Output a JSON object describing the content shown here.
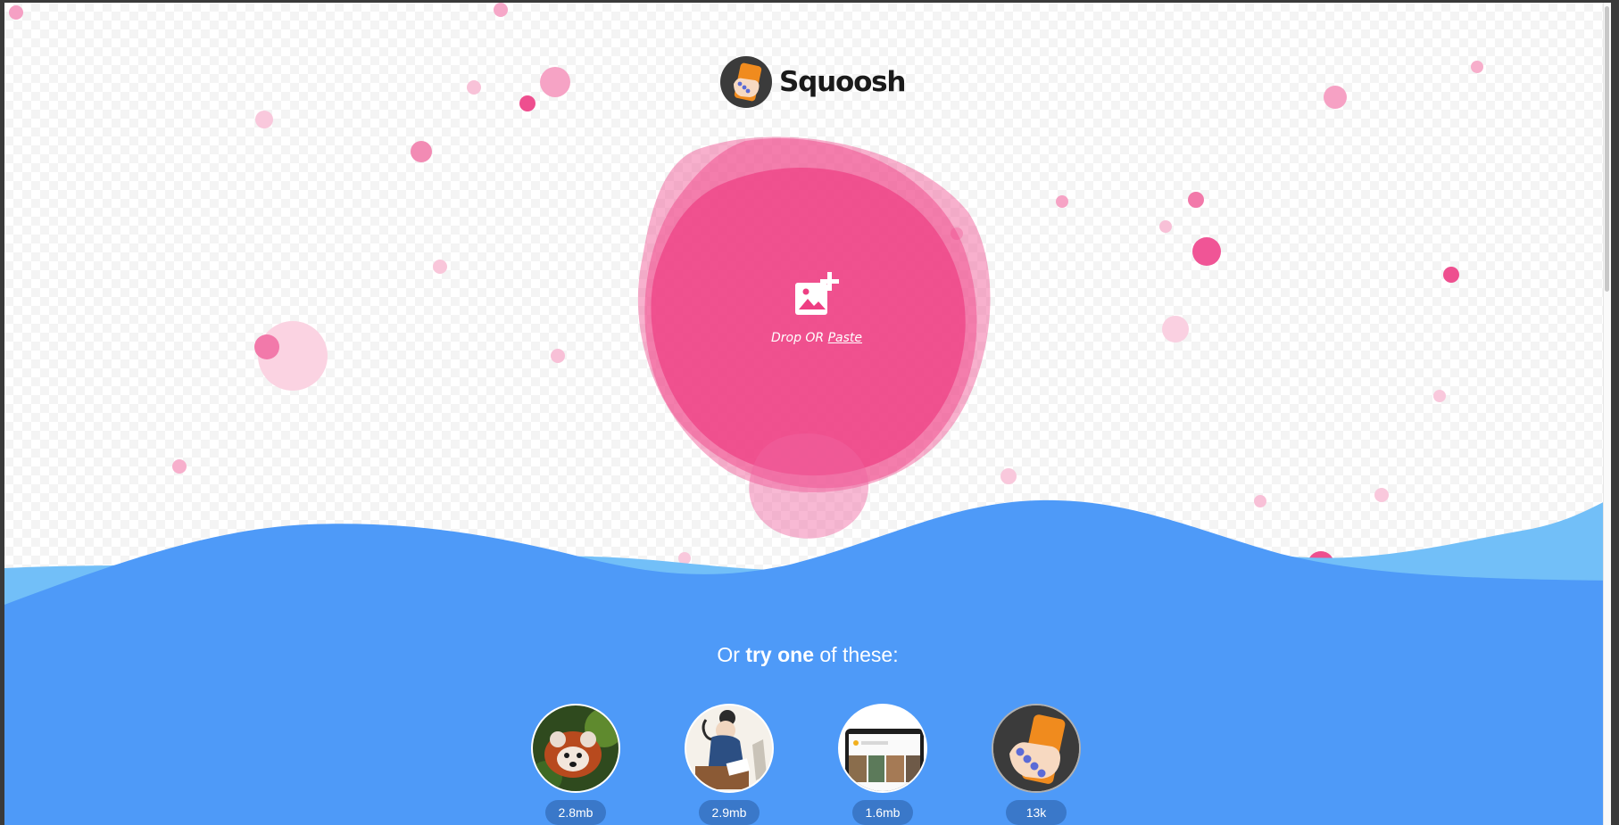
{
  "app": {
    "name": "Squoosh",
    "colors": {
      "accent_pink": "#f0428a",
      "wave_blue": "#4e9af8",
      "wave_light": "#72bff8",
      "pill": "#3a78c9"
    }
  },
  "dropzone": {
    "icon": "add-image-icon",
    "drop_text": "Drop OR ",
    "paste_label": "Paste"
  },
  "demos": {
    "heading_pre": "Or ",
    "heading_bold": "try one",
    "heading_post": " of these:",
    "items": [
      {
        "thumb": "red-panda-photo",
        "size": "2.8mb"
      },
      {
        "thumb": "artwork-illustration",
        "size": "2.9mb"
      },
      {
        "thumb": "device-screen",
        "size": "1.6mb"
      },
      {
        "thumb": "squoosh-logo-icon",
        "size": "13k"
      }
    ]
  }
}
